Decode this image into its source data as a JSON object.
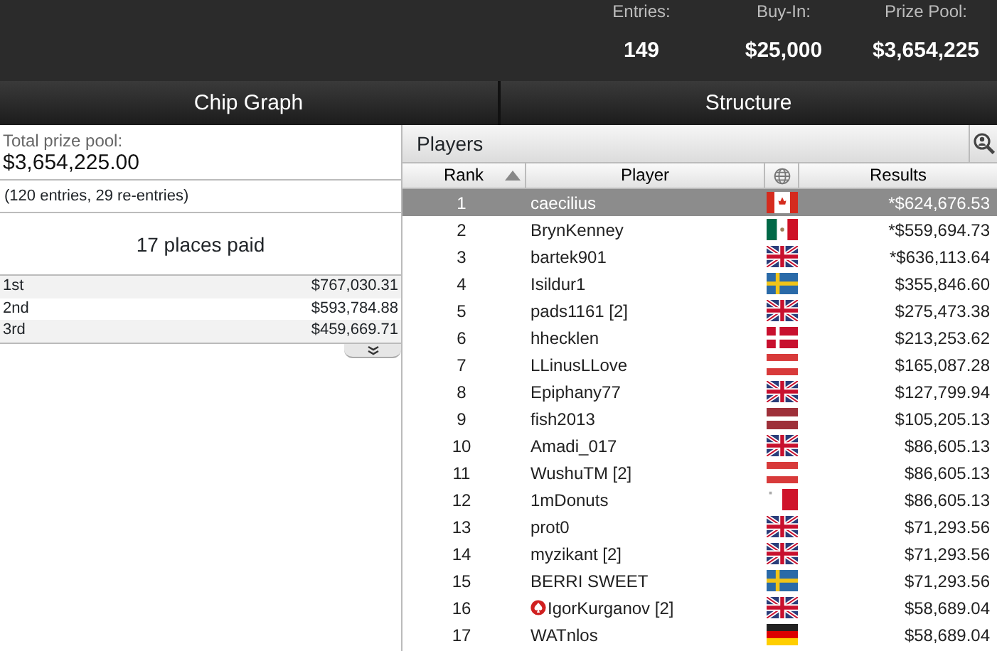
{
  "stats": [
    {
      "label": "Entries:",
      "value": "149"
    },
    {
      "label": "Buy-In:",
      "value": "$25,000"
    },
    {
      "label": "Prize Pool:",
      "value": "$3,654,225"
    }
  ],
  "tabs": [
    {
      "label": "Chip Graph",
      "selected": false
    },
    {
      "label": "Structure",
      "selected": false
    }
  ],
  "prize_panel": {
    "total_label": "Total prize pool:",
    "total": "$3,654,225.00",
    "entries_note": "(120 entries, 29 re-entries)",
    "places_paid": "17 places paid",
    "payouts": [
      {
        "place": "1st",
        "amount": "$767,030.31"
      },
      {
        "place": "2nd",
        "amount": "$593,784.88"
      },
      {
        "place": "3rd",
        "amount": "$459,669.71"
      }
    ]
  },
  "players": {
    "title": "Players",
    "columns": [
      "Rank",
      "Player",
      "Results"
    ],
    "rows": [
      {
        "rank": "1",
        "player": "caecilius",
        "kind": "ca",
        "result": "*$624,676.53",
        "selected": true,
        "pro": false
      },
      {
        "rank": "2",
        "player": "BrynKenney",
        "kind": "mx",
        "result": "*$559,694.73",
        "selected": false,
        "pro": false
      },
      {
        "rank": "3",
        "player": "bartek901",
        "kind": "gb",
        "result": "*$636,113.64",
        "selected": false,
        "pro": false
      },
      {
        "rank": "4",
        "player": "Isildur1",
        "kind": "se",
        "result": "$355,846.60",
        "selected": false,
        "pro": false
      },
      {
        "rank": "5",
        "player": "pads1161 [2]",
        "kind": "gb",
        "result": "$275,473.38",
        "selected": false,
        "pro": false
      },
      {
        "rank": "6",
        "player": "hhecklen",
        "kind": "dk",
        "result": "$213,253.62",
        "selected": false,
        "pro": false
      },
      {
        "rank": "7",
        "player": "LLinusLLove",
        "kind": "at",
        "result": "$165,087.28",
        "selected": false,
        "pro": false
      },
      {
        "rank": "8",
        "player": "Epiphany77",
        "kind": "gb",
        "result": "$127,799.94",
        "selected": false,
        "pro": false
      },
      {
        "rank": "9",
        "player": "fish2013",
        "kind": "lv",
        "result": "$105,205.13",
        "selected": false,
        "pro": false
      },
      {
        "rank": "10",
        "player": "Amadi_017",
        "kind": "gb",
        "result": "$86,605.13",
        "selected": false,
        "pro": false
      },
      {
        "rank": "11",
        "player": "WushuTM [2]",
        "kind": "at",
        "result": "$86,605.13",
        "selected": false,
        "pro": false
      },
      {
        "rank": "12",
        "player": "1mDonuts",
        "kind": "mt",
        "result": "$86,605.13",
        "selected": false,
        "pro": false
      },
      {
        "rank": "13",
        "player": "prot0",
        "kind": "gb",
        "result": "$71,293.56",
        "selected": false,
        "pro": false
      },
      {
        "rank": "14",
        "player": "myzikant [2]",
        "kind": "gb",
        "result": "$71,293.56",
        "selected": false,
        "pro": false
      },
      {
        "rank": "15",
        "player": "BERRI SWEET",
        "kind": "se",
        "result": "$71,293.56",
        "selected": false,
        "pro": false
      },
      {
        "rank": "16",
        "player": "IgorKurganov [2]",
        "kind": "gb",
        "result": "$58,689.04",
        "selected": false,
        "pro": true
      },
      {
        "rank": "17",
        "player": "WATnlos",
        "kind": "de",
        "result": "$58,689.04",
        "selected": false,
        "pro": false
      }
    ]
  }
}
